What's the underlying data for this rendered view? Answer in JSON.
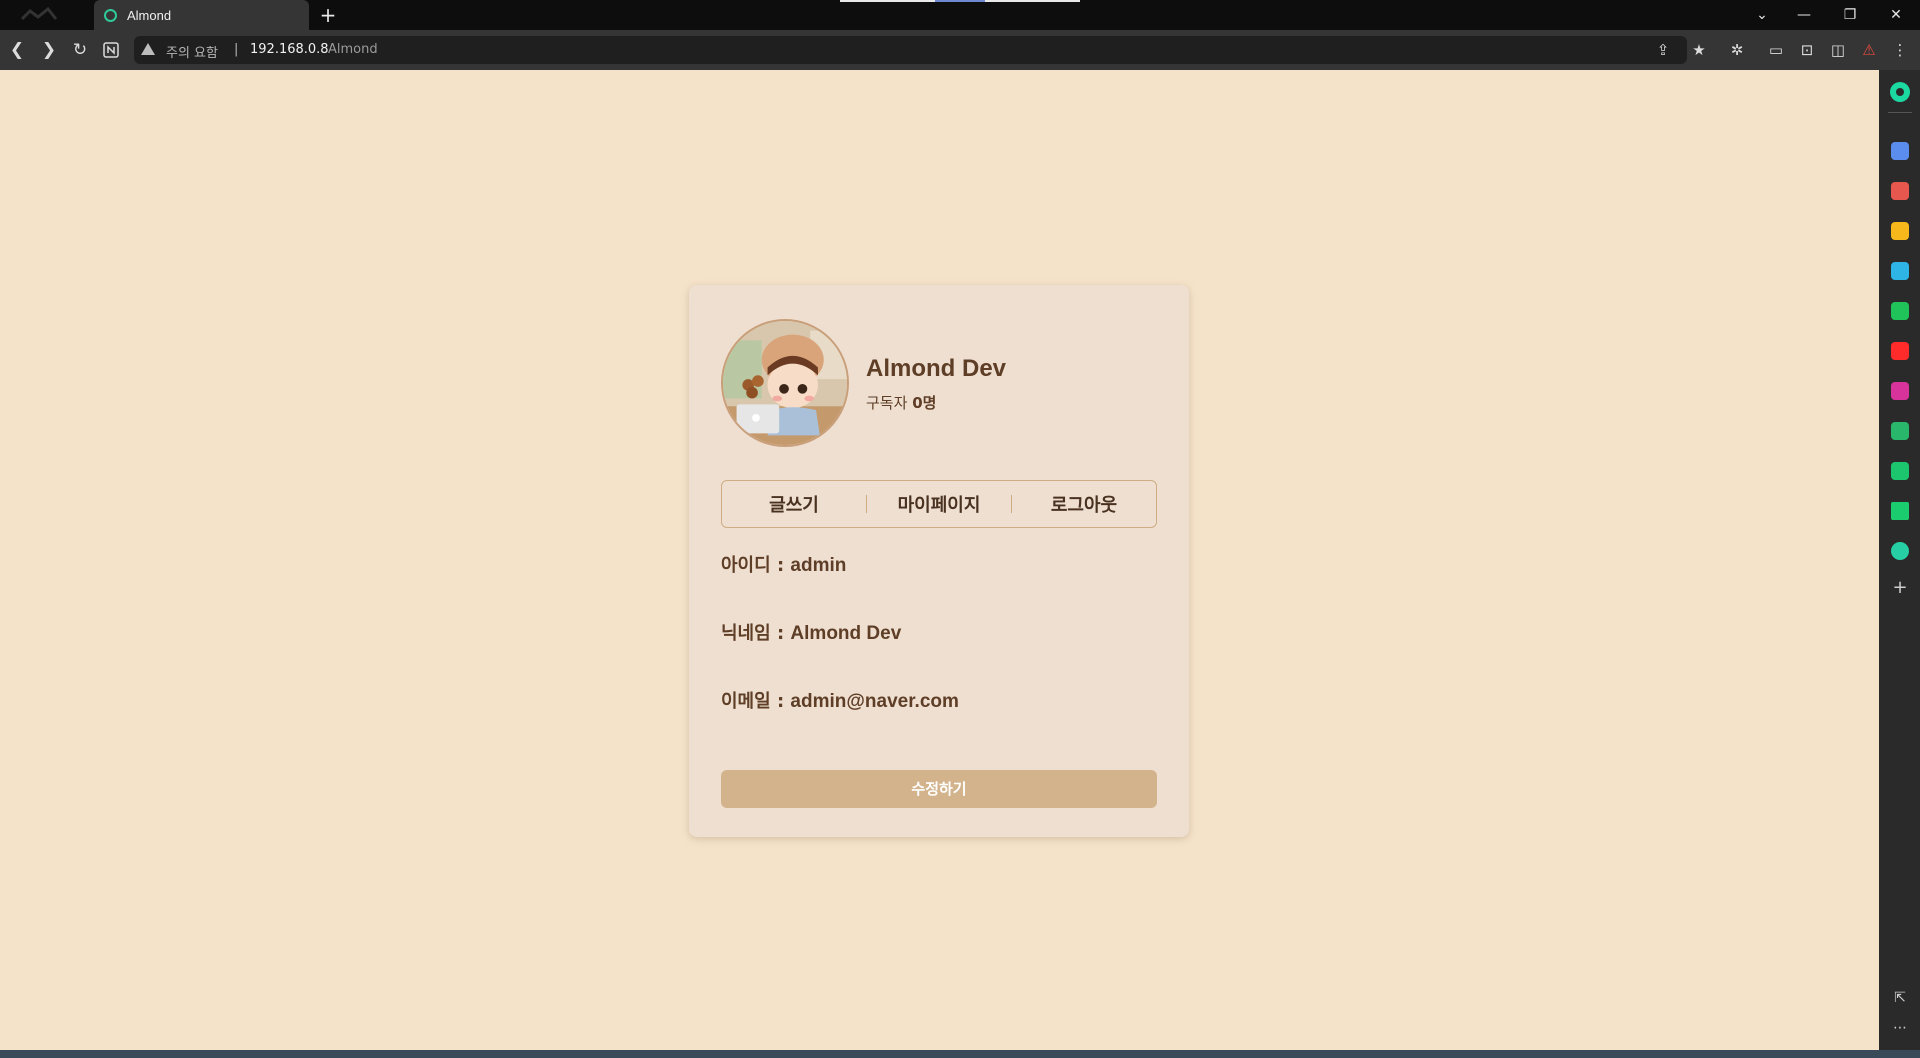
{
  "browser": {
    "tab_title": "Almond",
    "new_tab_label": "+",
    "security_label": "주의 요함",
    "url_separator": "|",
    "url_host": "192.168.0.8",
    "url_title": "Almond"
  },
  "profile": {
    "name": "Almond Dev",
    "subscribers_label": "구독자",
    "subscribers_count": "0명"
  },
  "menu": {
    "write": "글쓰기",
    "mypage": "마이페이지",
    "logout": "로그아웃"
  },
  "fields": {
    "id_label": "아이디 : ",
    "id_value": "admin",
    "nickname_label": "닉네임 : ",
    "nickname_value": "Almond Dev",
    "email_label": "이메일 : ",
    "email_value": "admin@naver.com"
  },
  "edit_button": "수정하기",
  "colors": {
    "page_bg": "#f5e3c9",
    "card_bg": "#efdfd1",
    "text_brown": "#5e3e26",
    "button_bg": "#d2b38c",
    "accent_green": "#1bd9a0"
  }
}
